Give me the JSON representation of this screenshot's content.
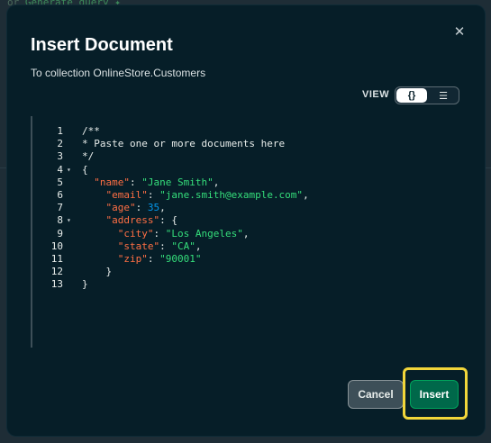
{
  "background": {
    "hint_prefix": "or",
    "hint_link": "Generate query ✦"
  },
  "modal": {
    "title": "Insert Document",
    "subtitle": "To collection OnlineStore.Customers",
    "close_icon": "close-icon",
    "view_label": "VIEW",
    "view_options": [
      {
        "label": "{}",
        "icon": "json-braces-icon",
        "active": true
      },
      {
        "label": "☰",
        "icon": "list-icon",
        "active": false
      }
    ],
    "editor": {
      "lines": [
        {
          "num": "1",
          "fold": "",
          "text": "/**"
        },
        {
          "num": "2",
          "fold": "",
          "text": "* Paste one or more documents here"
        },
        {
          "num": "3",
          "fold": "",
          "text": "*/"
        },
        {
          "num": "4",
          "fold": "▾",
          "text": "{"
        },
        {
          "num": "5",
          "fold": "",
          "text": "  \"name\": \"Jane Smith\","
        },
        {
          "num": "6",
          "fold": "",
          "text": "    \"email\": \"jane.smith@example.com\","
        },
        {
          "num": "7",
          "fold": "",
          "text": "    \"age\": 35,"
        },
        {
          "num": "8",
          "fold": "▾",
          "text": "    \"address\": {"
        },
        {
          "num": "9",
          "fold": "",
          "text": "      \"city\": \"Los Angeles\","
        },
        {
          "num": "10",
          "fold": "",
          "text": "      \"state\": \"CA\","
        },
        {
          "num": "11",
          "fold": "",
          "text": "      \"zip\": \"90001\""
        },
        {
          "num": "12",
          "fold": "",
          "text": "    }"
        },
        {
          "num": "13",
          "fold": "",
          "text": "}"
        }
      ]
    },
    "cancel_label": "Cancel",
    "insert_label": "Insert",
    "colors": {
      "modal_bg": "#061e28",
      "key": "#ff6f44",
      "string": "#35de7b",
      "number": "#0498ec",
      "insert_bg": "#00684a",
      "highlight": "#f2d63a"
    }
  }
}
